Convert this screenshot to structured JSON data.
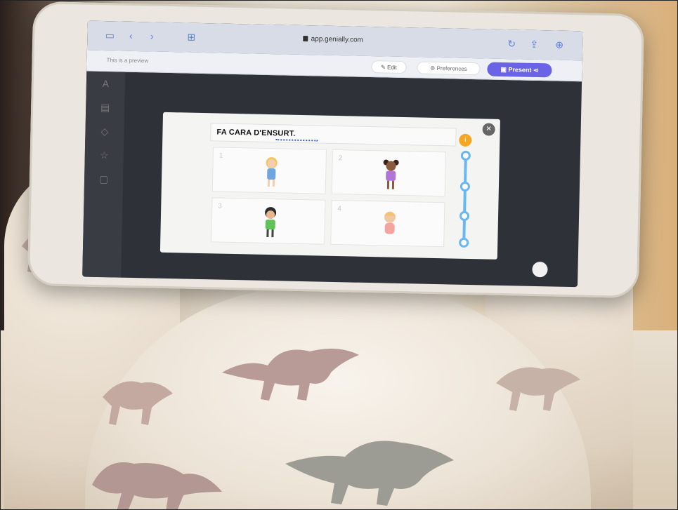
{
  "browser": {
    "url": "app.genially.com",
    "address_icon": "lock-icon",
    "toolbar_icons": [
      "sidebar-icon",
      "back-icon",
      "forward-icon",
      "tabs-icon",
      "reload-icon",
      "share-icon",
      "new-tab-icon"
    ]
  },
  "app_bar": {
    "left_text": "This is a preview",
    "edit_label": "Edit",
    "preferences_label": "Preferences",
    "present_label": "Present",
    "share_icon": "share-icon",
    "accent_color": "#6b63e6"
  },
  "slide": {
    "title": "FA CARA D'ENSURT.",
    "options": [
      {
        "number": "1",
        "character": "blonde-girl-blue-dress"
      },
      {
        "number": "2",
        "character": "girl-purple-shirt"
      },
      {
        "number": "3",
        "character": "boy-green-shirt"
      },
      {
        "number": "4",
        "character": "baby-pink"
      }
    ],
    "progress_steps": 4,
    "progress_color": "#68b7f0",
    "help_icon": "info-icon",
    "close_icon": "close-icon"
  },
  "scene": {
    "description_colors": {
      "pajama": "#efe6d8",
      "dinosaur": "#b79a94",
      "dinosaur_grey": "#9a9a93"
    }
  }
}
